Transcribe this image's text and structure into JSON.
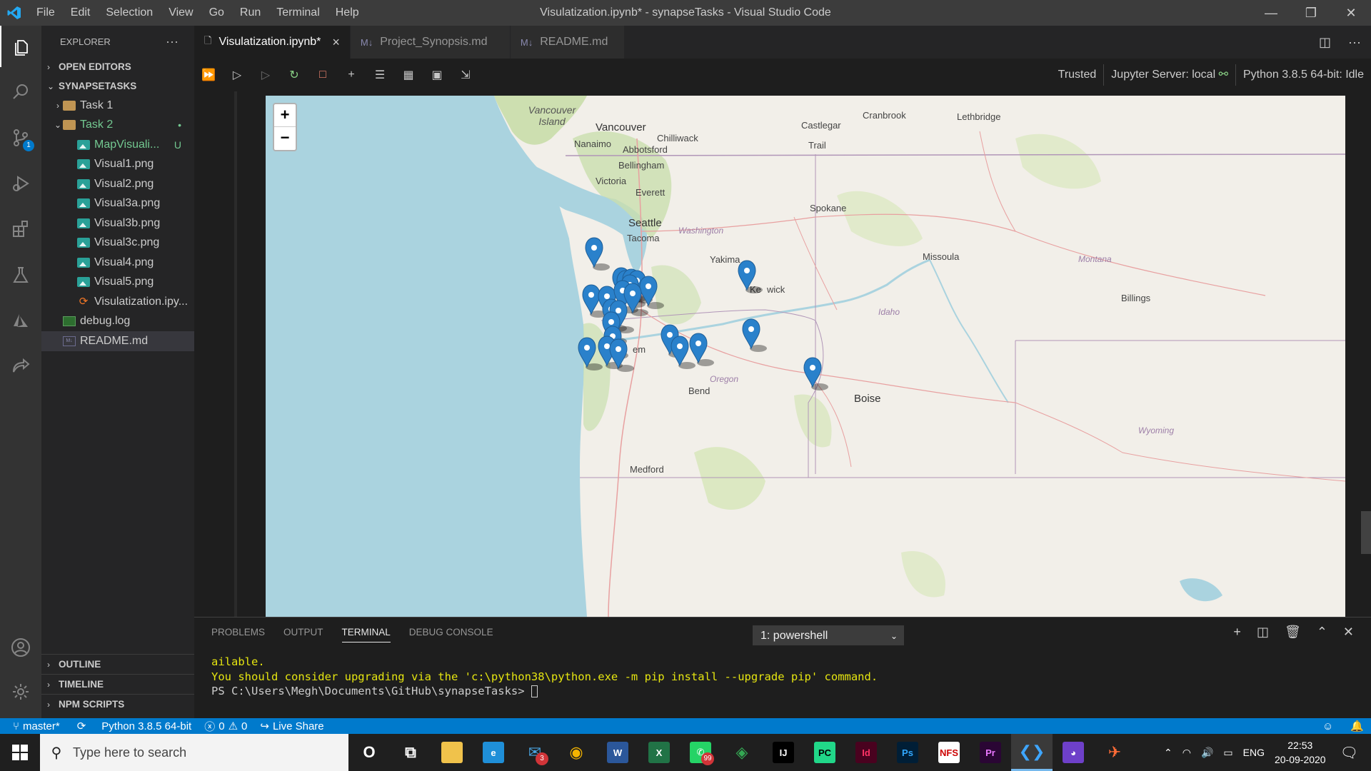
{
  "window": {
    "title": "Visulatization.ipynb* - synapseTasks - Visual Studio Code",
    "menu": [
      "File",
      "Edit",
      "Selection",
      "View",
      "Go",
      "Run",
      "Terminal",
      "Help"
    ]
  },
  "activity": {
    "items": [
      "explorer-icon",
      "search-icon",
      "source-control-icon",
      "run-debug-icon",
      "extensions-icon",
      "testing-icon",
      "azure-icon",
      "live-share-icon"
    ],
    "scm_badge": "1",
    "bottom": [
      "account-icon",
      "settings-gear-icon"
    ]
  },
  "sidebar": {
    "title": "EXPLORER",
    "more": "···",
    "open_editors": "OPEN EDITORS",
    "workspace": "SYNAPSETASKS",
    "tree": [
      {
        "label": "Task 1",
        "type": "folder",
        "indent": 1,
        "twist": "›"
      },
      {
        "label": "Task 2",
        "type": "folder",
        "indent": 1,
        "twist": "⌄",
        "status": "•",
        "color": "#73c991"
      },
      {
        "label": "MapVisuali...",
        "type": "image",
        "indent": 2,
        "status": "U",
        "color": "#73c991"
      },
      {
        "label": "Visual1.png",
        "type": "image",
        "indent": 2
      },
      {
        "label": "Visual2.png",
        "type": "image",
        "indent": 2
      },
      {
        "label": "Visual3a.png",
        "type": "image",
        "indent": 2
      },
      {
        "label": "Visual3b.png",
        "type": "image",
        "indent": 2
      },
      {
        "label": "Visual3c.png",
        "type": "image",
        "indent": 2
      },
      {
        "label": "Visual4.png",
        "type": "image",
        "indent": 2
      },
      {
        "label": "Visual5.png",
        "type": "image",
        "indent": 2
      },
      {
        "label": "Visulatization.ipy...",
        "type": "notebook",
        "indent": 2
      },
      {
        "label": "debug.log",
        "type": "log",
        "indent": 1
      },
      {
        "label": "README.md",
        "type": "md",
        "indent": 1,
        "selected": true
      }
    ],
    "bottom_sections": [
      "OUTLINE",
      "TIMELINE",
      "NPM SCRIPTS"
    ]
  },
  "tabs": [
    {
      "label": "Visulatization.ipynb*",
      "active": true,
      "close": "×"
    },
    {
      "label": "Project_Synopsis.md",
      "active": false
    },
    {
      "label": "README.md",
      "active": false
    }
  ],
  "notebook": {
    "toolbar_icons": [
      "run-all-icon",
      "run-above-icon",
      "run-below-icon",
      "restart-kernel-icon",
      "interrupt-icon",
      "add-cell-icon",
      "clear-outputs-icon",
      "variables-icon",
      "save-icon",
      "export-icon"
    ],
    "trusted": "Trusted",
    "server": "Jupyter Server: local",
    "kernel": "Python 3.8.5 64-bit: Idle"
  },
  "map": {
    "zoom_in": "+",
    "zoom_out": "−",
    "labels": [
      {
        "text": "Vancouver Island",
        "cls": "island"
      },
      {
        "text": "Vancouver",
        "cls": "big"
      },
      {
        "text": "Chilliwack",
        "cls": ""
      },
      {
        "text": "Nanaimo",
        "cls": ""
      },
      {
        "text": "Abbotsford",
        "cls": ""
      },
      {
        "text": "Bellingham",
        "cls": ""
      },
      {
        "text": "Victoria",
        "cls": ""
      },
      {
        "text": "Everett",
        "cls": ""
      },
      {
        "text": "Seattle",
        "cls": "big"
      },
      {
        "text": "Tacoma",
        "cls": ""
      },
      {
        "text": "Washington",
        "cls": "state"
      },
      {
        "text": "Yakima",
        "cls": ""
      },
      {
        "text": "Spokane",
        "cls": ""
      },
      {
        "text": "Castlegar",
        "cls": ""
      },
      {
        "text": "Trail",
        "cls": ""
      },
      {
        "text": "Cranbrook",
        "cls": ""
      },
      {
        "text": "Lethbridge",
        "cls": ""
      },
      {
        "text": "Missoula",
        "cls": ""
      },
      {
        "text": "Montana",
        "cls": "state"
      },
      {
        "text": "Billings",
        "cls": ""
      },
      {
        "text": "Idaho",
        "cls": "state"
      },
      {
        "text": "Ke",
        "cls": ""
      },
      {
        "text": "wick",
        "cls": ""
      },
      {
        "text": "Bend",
        "cls": ""
      },
      {
        "text": "Oregon",
        "cls": "state"
      },
      {
        "text": "Boise",
        "cls": "big"
      },
      {
        "text": "Medford",
        "cls": ""
      },
      {
        "text": "Wyoming",
        "cls": "state"
      },
      {
        "text": "em",
        "cls": ""
      }
    ],
    "marker_color": "#2a81cb"
  },
  "panel": {
    "tabs": [
      "PROBLEMS",
      "OUTPUT",
      "TERMINAL",
      "DEBUG CONSOLE"
    ],
    "active_tab": "TERMINAL",
    "terminal_select": "1: powershell",
    "lines": [
      {
        "text": "ailable.",
        "cls": "t-yellow"
      },
      {
        "text": "You should consider upgrading via the 'c:\\python38\\python.exe -m pip install --upgrade pip' command.",
        "cls": "t-yellow"
      },
      {
        "text": "PS C:\\Users\\Megh\\Documents\\GitHub\\synapseTasks> ",
        "cls": "t-white"
      }
    ]
  },
  "statusbar": {
    "branch": "master*",
    "python": "Python 3.8.5 64-bit",
    "errors": "0",
    "warnings": "0",
    "liveshare": "Live Share"
  },
  "taskbar": {
    "search_placeholder": "Type here to search",
    "apps": [
      {
        "name": "cortana-icon",
        "label": "O",
        "bg": "transparent",
        "fg": "#ffffff"
      },
      {
        "name": "task-view-icon",
        "label": "⧉",
        "bg": "transparent",
        "fg": "#ffffff"
      },
      {
        "name": "file-explorer-icon",
        "label": "",
        "bg": "#f0c24b",
        "fg": "#000"
      },
      {
        "name": "edge-icon",
        "label": "e",
        "bg": "#1f8fd8",
        "fg": "#ffffff"
      },
      {
        "name": "mail-icon",
        "label": "✉",
        "bg": "transparent",
        "fg": "#4aa3df",
        "badge": "3"
      },
      {
        "name": "chrome-icon",
        "label": "◉",
        "bg": "transparent",
        "fg": "#f4b400"
      },
      {
        "name": "word-icon",
        "label": "W",
        "bg": "#2b579a",
        "fg": "#ffffff"
      },
      {
        "name": "excel-icon",
        "label": "X",
        "bg": "#217346",
        "fg": "#ffffff"
      },
      {
        "name": "whatsapp-icon",
        "label": "✆",
        "bg": "#25d366",
        "fg": "#ffffff",
        "badge": "99"
      },
      {
        "name": "maps-icon",
        "label": "◈",
        "bg": "transparent",
        "fg": "#34a853"
      },
      {
        "name": "intellij-icon",
        "label": "IJ",
        "bg": "#000000",
        "fg": "#ffffff"
      },
      {
        "name": "pycharm-icon",
        "label": "PC",
        "bg": "#21d789",
        "fg": "#000000"
      },
      {
        "name": "indesign-icon",
        "label": "Id",
        "bg": "#49021f",
        "fg": "#ff3366"
      },
      {
        "name": "photoshop-icon",
        "label": "Ps",
        "bg": "#001e36",
        "fg": "#31a8ff"
      },
      {
        "name": "nfs-icon",
        "label": "NFS",
        "bg": "#ffffff",
        "fg": "#cc0000"
      },
      {
        "name": "premiere-icon",
        "label": "Pr",
        "bg": "#2a0634",
        "fg": "#ea77ff"
      },
      {
        "name": "vscode-icon",
        "label": "❮❯",
        "bg": "transparent",
        "fg": "#3ea6ff",
        "active": true
      },
      {
        "name": "github-desktop-icon",
        "label": "◕",
        "bg": "#6e40c9",
        "fg": "#ffffff"
      },
      {
        "name": "postman-icon",
        "label": "✈",
        "bg": "transparent",
        "fg": "#ff6c37"
      }
    ],
    "lang": "ENG",
    "time": "22:53",
    "date": "20-09-2020"
  }
}
